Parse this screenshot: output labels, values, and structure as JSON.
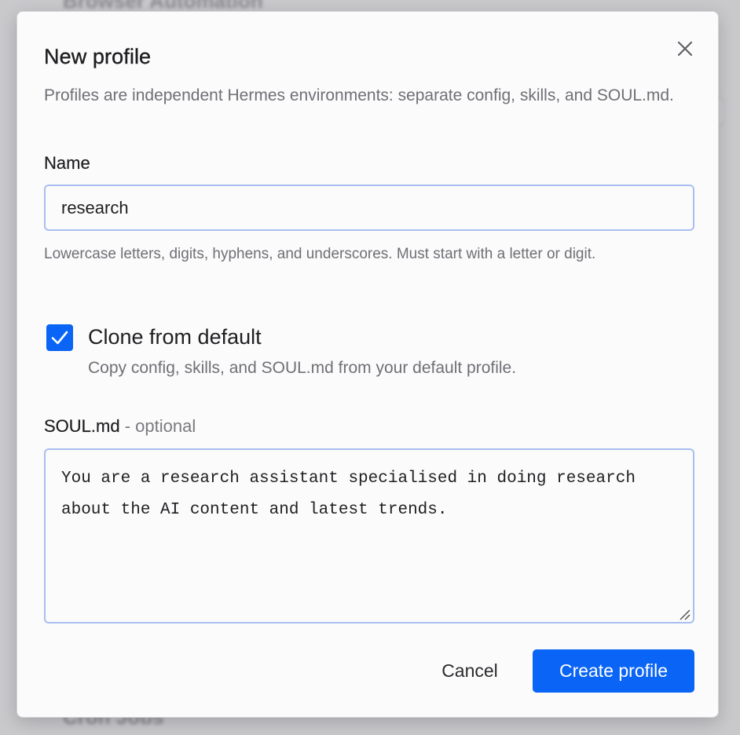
{
  "dialog": {
    "title": "New profile",
    "description": "Profiles are independent Hermes environments: separate config, skills, and SOUL.md."
  },
  "name_field": {
    "label": "Name",
    "value": "research",
    "hint": "Lowercase letters, digits, hyphens, and underscores. Must start with a letter or digit."
  },
  "clone_option": {
    "checked": true,
    "label": "Clone from default",
    "description": "Copy config, skills, and SOUL.md from your default profile."
  },
  "soul_field": {
    "label": "SOUL.md",
    "optional_suffix": " - optional",
    "value": "You are a research assistant specialised in doing research about the AI content and latest trends."
  },
  "actions": {
    "cancel_label": "Cancel",
    "create_label": "Create profile"
  },
  "background": {
    "top_heading": "Browser Automation",
    "bottom_heading": "Cron Jobs"
  },
  "icons": {
    "close": "close-icon",
    "checkmark": "checkmark-icon",
    "resize": "resize-handle-icon"
  },
  "colors": {
    "accent": "#0a64f5",
    "input_border": "#a9bef0",
    "muted_text": "#6f6f76"
  }
}
